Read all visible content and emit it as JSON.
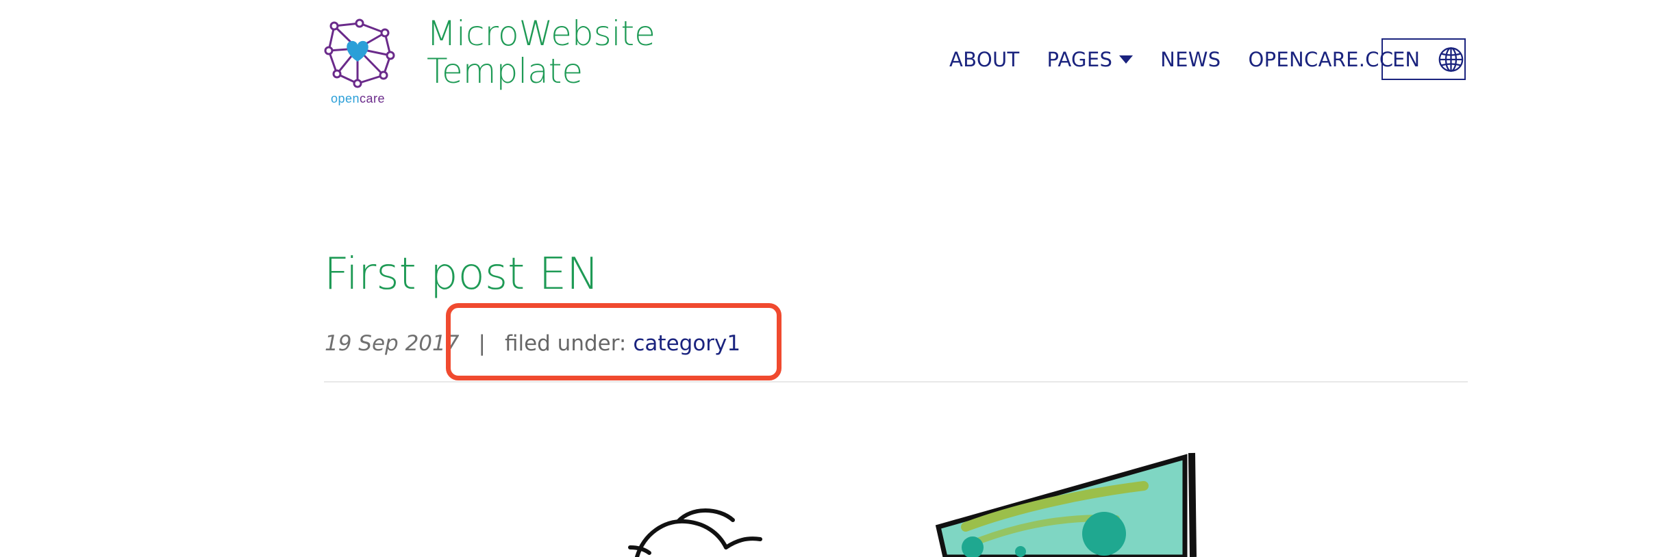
{
  "header": {
    "logo": {
      "word_open": "open",
      "word_care": "care"
    },
    "site_title_line1": "MicroWebsite",
    "site_title_line2": "Template",
    "nav": {
      "about": "ABOUT",
      "pages": "PAGES",
      "news": "NEWS",
      "opencare": "OPENCARE.CC"
    },
    "language": {
      "current": "EN",
      "icon": "globe-icon"
    }
  },
  "post": {
    "title": "First post EN",
    "date": "19 Sep 2017",
    "separator": "|",
    "filed_under_label": "filed under:",
    "category": "category1"
  },
  "colors": {
    "brand_green": "#1e9a55",
    "nav_navy": "#1a237e",
    "highlight_red": "#f04a2f",
    "logo_purple": "#6a2a8a",
    "logo_blue": "#2b9fd8"
  }
}
